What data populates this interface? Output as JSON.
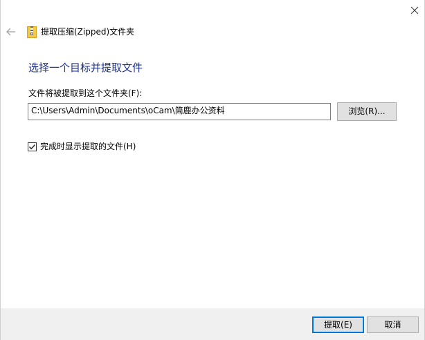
{
  "nav": {
    "title": "提取压缩(Zipped)文件夹",
    "back_icon": "back-arrow-icon",
    "folder_icon": "zip-folder-icon",
    "close_icon": "close-icon"
  },
  "main": {
    "heading": "选择一个目标并提取文件",
    "path_label": "文件将被提取到这个文件夹(F):",
    "path_value": "C:\\Users\\Admin\\Documents\\oCam\\简鹿办公资料",
    "browse_label": "浏览(R)...",
    "show_files_label": "完成时显示提取的文件(H)",
    "show_files_checked": true
  },
  "footer": {
    "extract_label": "提取(E)",
    "cancel_label": "取消"
  },
  "colors": {
    "heading": "#1e3287",
    "footer_bg": "#f0f0f0",
    "default_button_border": "#0078d7",
    "button_bg": "#e1e1e1"
  }
}
